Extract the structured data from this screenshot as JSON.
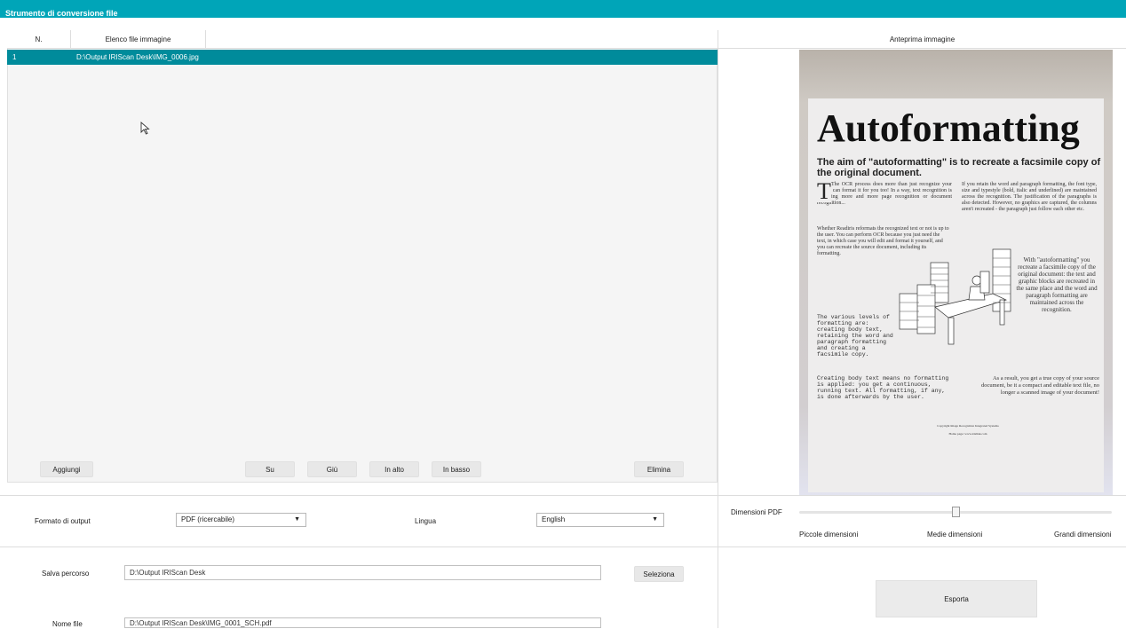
{
  "window": {
    "title": "Strumento di conversione file"
  },
  "list": {
    "headers": {
      "num": "N.",
      "files": "Elenco file immagine"
    },
    "rows": [
      {
        "num": "1",
        "path": "D:\\Output IRIScan Desk\\IMG_0006.jpg"
      }
    ]
  },
  "preview": {
    "header": "Anteprima immagine",
    "doc": {
      "title": "Autoformatting",
      "subtitle": "The aim of \"autoformatting\" is to recreate a facsimile copy of the original document.",
      "col1a": "The OCR process does more than just recognize your text, it can format it for you too! In a way, text recognition is becoming more and more page recognition or document recognition...",
      "col1b": "Whether Readiris reformats the recognized text or not is up to the user. You can perform OCR because you just need the text, in which case you will edit and format it yourself, and you can recreate the source document, including its formatting.",
      "mono1": "The various levels of formatting are: creating body text, retaining the word and paragraph formatting and creating a facsimile copy.",
      "mono2": "Creating body text means no formatting is applied: you get a continuous, running text. All formatting, if any, is done afterwards by the user.",
      "col2a": "If you retain the word and paragraph formatting, the font type, size and typestyle (bold, italic and underlined) are maintained across the recognition. The justification of the paragraphs is also detected. However, no graphics are captured, the columns aren't recreated - the paragraph just follow each other etc.",
      "col2b": "With \"autoformatting\" you recreate a facsimile copy of the original document: the text and graphic blocks are recreated in the same place and the word and paragraph formatting are maintained across the recognition.",
      "col2c": "As a result, you get a true copy of your source document, be it a compact and editable text file, no longer a scanned image of your document!",
      "footer1": "Copyright Image Recognition Integrated Systems",
      "footer2": "Home page: www.irislink.com"
    }
  },
  "buttons": {
    "add": "Aggiungi",
    "up": "Su",
    "down": "Giù",
    "top": "In alto",
    "bottom": "In basso",
    "delete": "Elimina",
    "select": "Seleziona",
    "export": "Esporta"
  },
  "options": {
    "format_label": "Formato di output",
    "format_value": "PDF (ricercabile)",
    "language_label": "Lingua",
    "language_value": "English"
  },
  "pdf_size": {
    "label": "Dimensioni PDF",
    "small": "Piccole dimensioni",
    "medium": "Medie dimensioni",
    "large": "Grandi dimensioni",
    "level": 0.5
  },
  "save": {
    "path_label": "Salva percorso",
    "path_value": "D:\\Output IRIScan Desk",
    "name_label": "Nome file",
    "name_value": "D:\\Output IRIScan Desk\\IMG_0001_SCH.pdf"
  },
  "colors": {
    "accent": "#00a5b8",
    "selected_row": "#008b9b"
  }
}
